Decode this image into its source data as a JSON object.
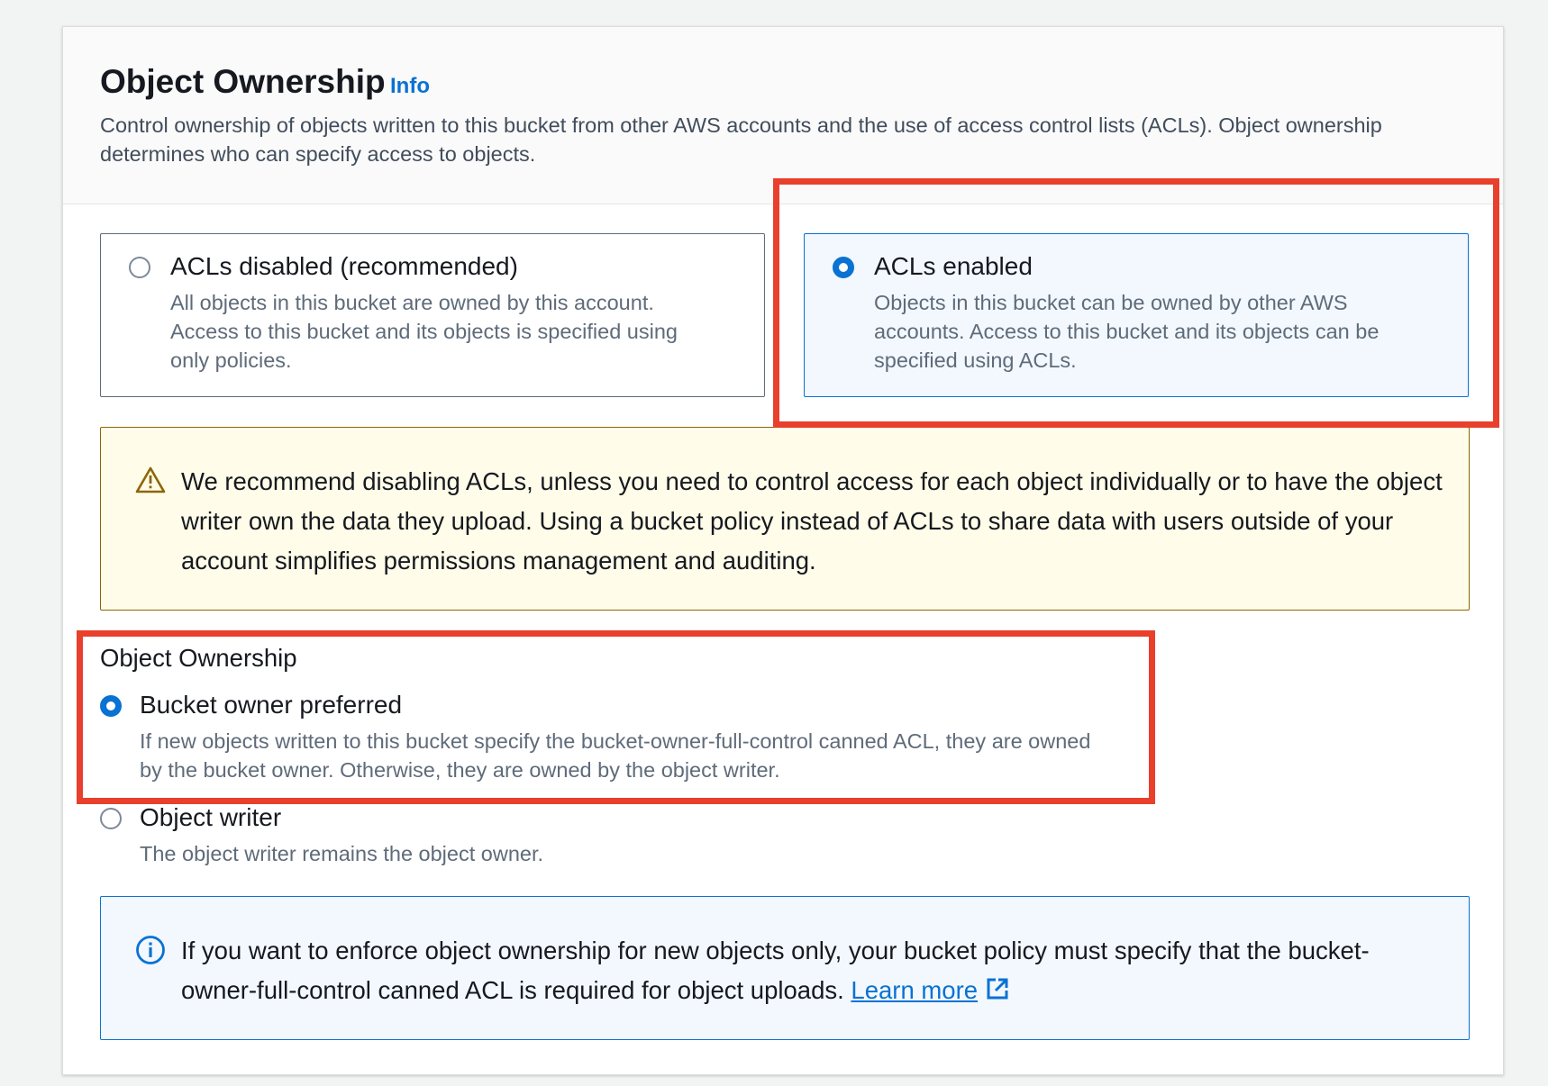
{
  "section": {
    "title": "Object Ownership",
    "info_link": "Info",
    "description": "Control ownership of objects written to this bucket from other AWS accounts and the use of access control lists (ACLs). Object ownership determines who can specify access to objects."
  },
  "acl_tiles": [
    {
      "label": "ACLs disabled (recommended)",
      "description": "All objects in this bucket are owned by this account. Access to this bucket and its objects is specified using only policies.",
      "selected": false
    },
    {
      "label": "ACLs enabled",
      "description": "Objects in this bucket can be owned by other AWS accounts. Access to this bucket and its objects can be specified using ACLs.",
      "selected": true
    }
  ],
  "warning_alert": {
    "icon": "warning-icon",
    "text": "We recommend disabling ACLs, unless you need to control access for each object individually or to have the object writer own the data they upload. Using a bucket policy instead of ACLs to share data with users outside of your account simplifies permissions management and auditing."
  },
  "ownership_field": {
    "label": "Object Ownership",
    "options": [
      {
        "label": "Bucket owner preferred",
        "description": "If new objects written to this bucket specify the bucket-owner-full-control canned ACL, they are owned by the bucket owner. Otherwise, they are owned by the object writer.",
        "selected": true
      },
      {
        "label": "Object writer",
        "description": "The object writer remains the object owner.",
        "selected": false
      }
    ]
  },
  "info_alert": {
    "icon": "info-icon",
    "text": "If you want to enforce object ownership for new objects only, your bucket policy must specify that the bucket-owner-full-control canned ACL is required for object uploads.",
    "link_text": "Learn more",
    "link_icon": "external-link-icon"
  },
  "colors": {
    "accent": "#0972d3",
    "annotation_highlight": "#e8402c",
    "warning_border": "#8d6605",
    "warning_bg": "#fffce9"
  }
}
